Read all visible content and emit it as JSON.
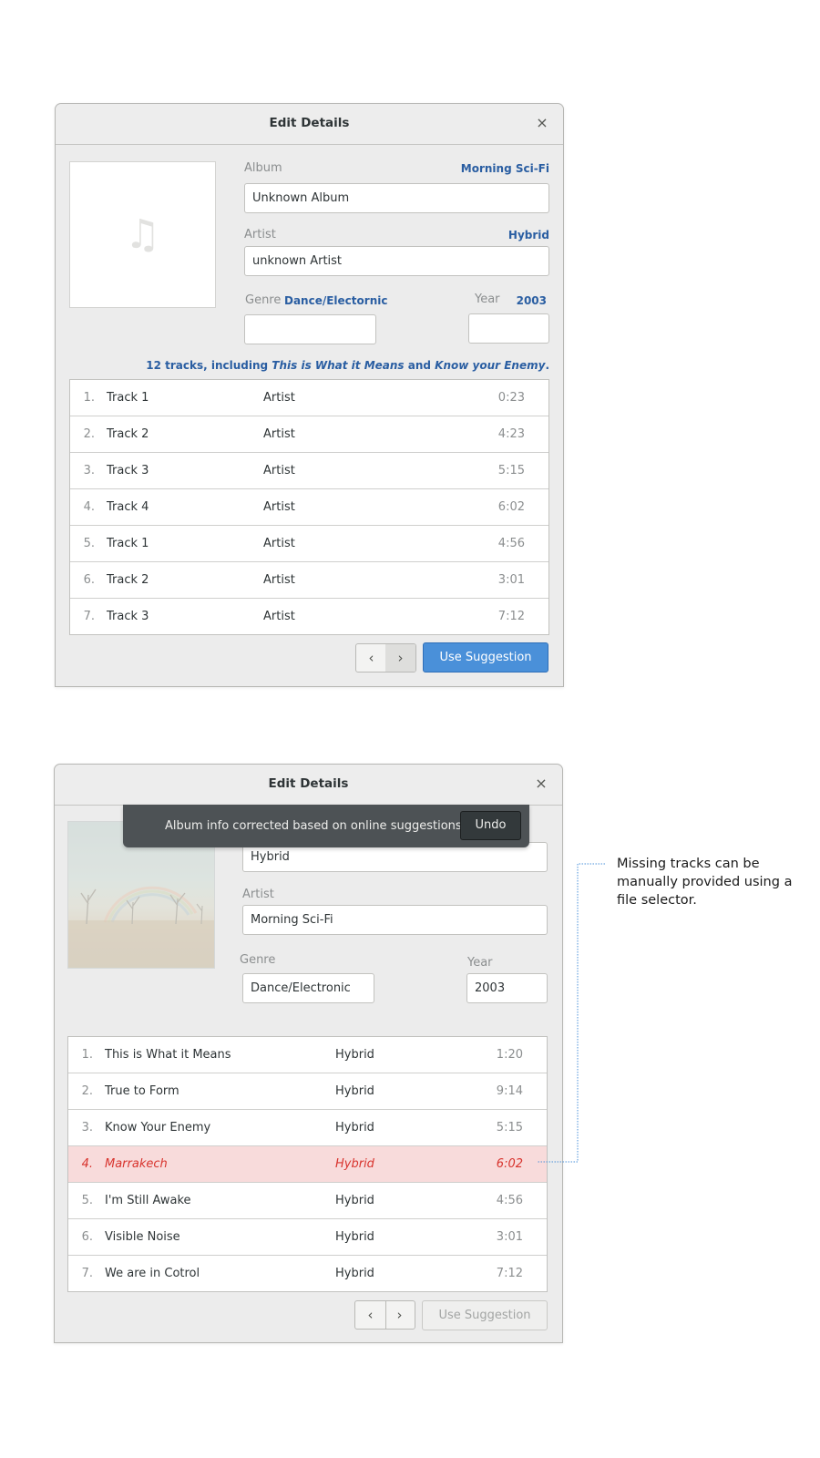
{
  "dialog_top": {
    "title": "Edit Details",
    "close_glyph": "×",
    "cover_icon": "music-note-icon",
    "cover_glyph": "♫",
    "album_label": "Album",
    "album_suggestion": "Morning Sci-Fi",
    "album_value": "Unknown Album",
    "artist_label": "Artist",
    "artist_suggestion": "Hybrid",
    "artist_value": "unknown Artist",
    "genre_label": "Genre",
    "genre_suggestion": "Dance/Electornic",
    "genre_value": "",
    "year_label": "Year",
    "year_suggestion": "2003",
    "year_value": "",
    "tracks_summary": {
      "prefix": "12 tracks, including ",
      "track_a": "This is What it Means",
      "joiner": " and ",
      "track_b": "Know your Enemy",
      "suffix": "."
    },
    "tracks": [
      {
        "num": "1.",
        "name": "Track 1",
        "artist": "Artist",
        "duration": "0:23"
      },
      {
        "num": "2.",
        "name": "Track 2",
        "artist": "Artist",
        "duration": "4:23"
      },
      {
        "num": "3.",
        "name": "Track 3",
        "artist": "Artist",
        "duration": "5:15"
      },
      {
        "num": "4.",
        "name": "Track 4",
        "artist": "Artist",
        "duration": "6:02"
      },
      {
        "num": "5.",
        "name": "Track 1",
        "artist": "Artist",
        "duration": "4:56"
      },
      {
        "num": "6.",
        "name": "Track 2",
        "artist": "Artist",
        "duration": "3:01"
      },
      {
        "num": "7.",
        "name": "Track 3",
        "artist": "Artist",
        "duration": "7:12"
      }
    ],
    "prev_glyph": "‹",
    "next_glyph": "›",
    "use_suggestion_label": "Use Suggestion"
  },
  "dialog_bottom": {
    "title": "Edit Details",
    "close_glyph": "×",
    "toast_message": "Album info corrected based on online suggestions.",
    "undo_label": "Undo",
    "album_value": "Hybrid",
    "artist_label": "Artist",
    "artist_value": "Morning Sci-Fi",
    "genre_label": "Genre",
    "genre_value": "Dance/Electronic",
    "year_label": "Year",
    "year_value": "2003",
    "tracks": [
      {
        "num": "1.",
        "name": "This is What it Means",
        "artist": "Hybrid",
        "duration": "1:20",
        "missing": false
      },
      {
        "num": "2.",
        "name": "True to Form",
        "artist": "Hybrid",
        "duration": "9:14",
        "missing": false
      },
      {
        "num": "3.",
        "name": "Know Your Enemy",
        "artist": "Hybrid",
        "duration": "5:15",
        "missing": false
      },
      {
        "num": "4.",
        "name": "Marrakech",
        "artist": "Hybrid",
        "duration": "6:02",
        "missing": true
      },
      {
        "num": "5.",
        "name": "I'm Still Awake",
        "artist": "Hybrid",
        "duration": "4:56",
        "missing": false
      },
      {
        "num": "6.",
        "name": "Visible Noise",
        "artist": "Hybrid",
        "duration": "3:01",
        "missing": false
      },
      {
        "num": "7.",
        "name": "We are in Cotrol",
        "artist": "Hybrid",
        "duration": "7:12",
        "missing": false
      }
    ],
    "prev_glyph": "‹",
    "next_glyph": "›",
    "use_suggestion_label": "Use Suggestion"
  },
  "annotation": {
    "text": "Missing tracks can be manually provided using a file selector."
  },
  "colors": {
    "accent": "#4a90d9",
    "suggestion_text": "#2a5ea2",
    "missing_row_bg": "#f8dbdb",
    "missing_row_text": "#d8332d",
    "toast_bg": "#4d5255"
  }
}
